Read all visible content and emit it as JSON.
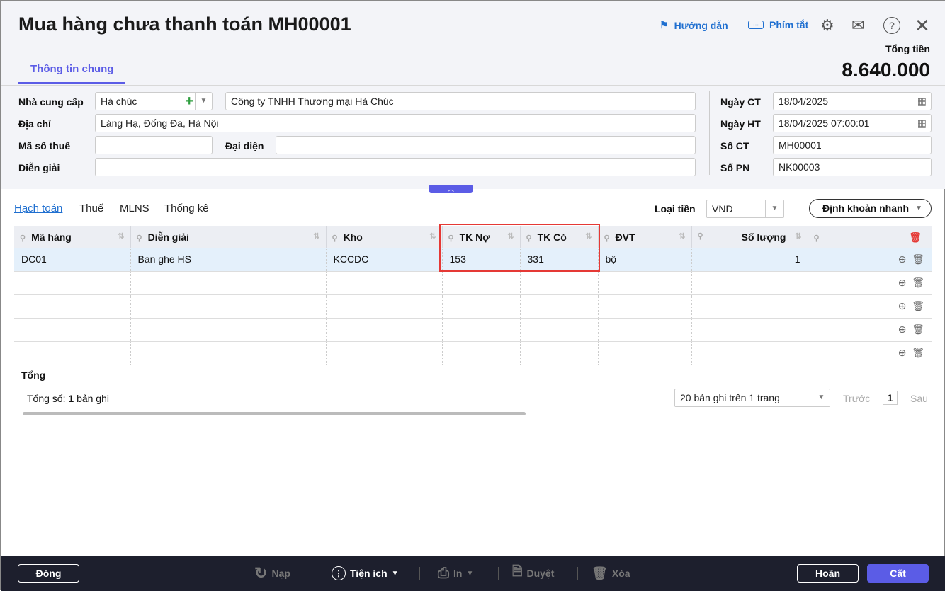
{
  "header": {
    "title": "Mua hàng chưa thanh toán MH00001",
    "guide": "Hướng dẫn",
    "shortcuts": "Phím tắt",
    "total_label": "Tổng tiền",
    "total_value": "8.640.000",
    "tab": "Thông tin chung"
  },
  "form": {
    "supplier_label": "Nhà cung cấp",
    "supplier_code": "Hà chúc",
    "supplier_name": "Công ty TNHH Thương mại Hà Chúc",
    "address_label": "Địa chỉ",
    "address": "Láng Hạ, Đống Đa, Hà Nội",
    "tax_label": "Mã số thuế",
    "tax": "",
    "rep_label": "Đại diện",
    "rep": "",
    "desc_label": "Diễn giải",
    "desc": "",
    "date_ct_label": "Ngày CT",
    "date_ct": "18/04/2025",
    "date_ht_label": "Ngày HT",
    "date_ht": "18/04/2025 07:00:01",
    "so_ct_label": "Số CT",
    "so_ct": "MH00001",
    "so_pn_label": "Số PN",
    "so_pn": "NK00003"
  },
  "subtabs": [
    "Hạch toán",
    "Thuế",
    "MLNS",
    "Thống kê"
  ],
  "currency": {
    "label": "Loại tiền",
    "value": "VND"
  },
  "quick_button": "Định khoản nhanh",
  "grid": {
    "columns": [
      "Mã hàng",
      "Diễn giải",
      "Kho",
      "TK Nợ",
      "TK Có",
      "ĐVT",
      "Số lượng",
      ""
    ],
    "rows": [
      [
        "DC01",
        "Ban ghe HS",
        "KCCDC",
        "153",
        "331",
        "bộ",
        "1",
        ""
      ]
    ],
    "total_label": "Tổng"
  },
  "pager": {
    "count_prefix": "Tổng số:",
    "count": "1",
    "count_suffix": "bản ghi",
    "page_size": "20 bản ghi trên 1 trang",
    "prev": "Trước",
    "page": "1",
    "next": "Sau"
  },
  "footer": {
    "close": "Đóng",
    "reload": "Nạp",
    "utilities": "Tiện ích",
    "print": "In",
    "approve": "Duyệt",
    "delete": "Xóa",
    "cancel": "Hoãn",
    "save": "Cất"
  },
  "colors": {
    "accent": "#5b5ce6",
    "link": "#1f6fd0",
    "highlight": "#e53935"
  }
}
